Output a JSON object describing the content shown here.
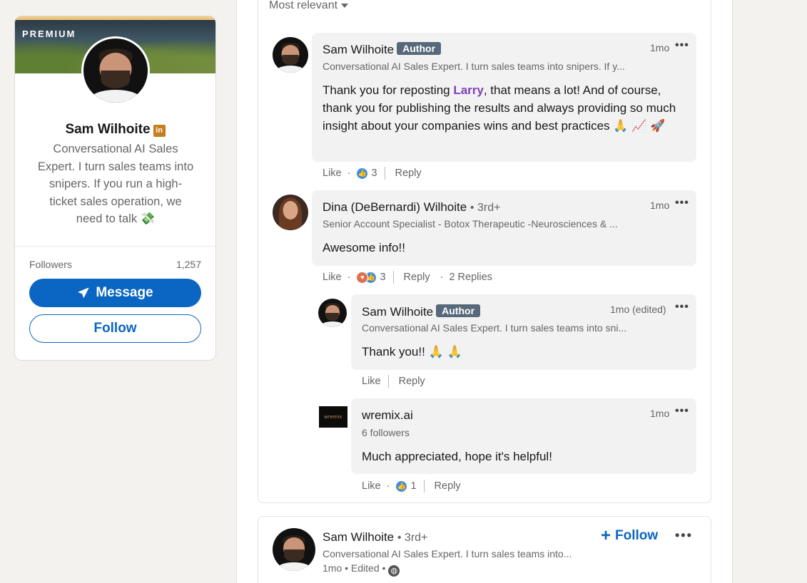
{
  "profile": {
    "premium_label": "PREMIUM",
    "name": "Sam Wilhoite",
    "linkedin_badge": "in",
    "headline": "Conversational AI Sales Expert. I turn sales teams into snipers. If you run a high-ticket sales operation, we need to talk 💸",
    "followers_label": "Followers",
    "followers_count": "1,257",
    "message_label": "Message",
    "follow_label": "Follow"
  },
  "sort": {
    "label": "Most relevant",
    "icon": "caret-down-icon"
  },
  "comments": [
    {
      "name": "Sam Wilhoite",
      "badge": "Author",
      "headline": "Conversational AI Sales Expert. I turn sales teams into snipers. If y...",
      "time": "1mo",
      "text_before": "Thank you for reposting ",
      "mention": "Larry",
      "text_after": ", that means a lot! And of course, thank you for publishing the results and always providing so much insight about your companies wins and best practices 🙏 📈 🚀",
      "like_label": "Like",
      "reaction_count": "3",
      "reply_label": "Reply"
    },
    {
      "name": "Dina (DeBernardi) Wilhoite",
      "degree": "• 3rd+",
      "headline": "Senior Account Specialist - Botox Therapeutic -Neurosciences & ...",
      "time": "1mo",
      "text": "Awesome info!!",
      "like_label": "Like",
      "reaction_count": "3",
      "reply_label": "Reply",
      "replies_label": "2 Replies",
      "replies": [
        {
          "name": "Sam Wilhoite",
          "badge": "Author",
          "headline": "Conversational AI Sales Expert. I turn sales teams into sni...",
          "time": "1mo (edited)",
          "text": "Thank you!! 🙏 🙏",
          "like_label": "Like",
          "reply_label": "Reply"
        },
        {
          "name": "wremix.ai",
          "logo_text": "wremix",
          "headline": "6 followers",
          "time": "1mo",
          "text": "Much appreciated, hope it's helpful!",
          "like_label": "Like",
          "reaction_count": "1",
          "reply_label": "Reply"
        }
      ]
    }
  ],
  "next_post": {
    "name": "Sam Wilhoite",
    "degree": "• 3rd+",
    "headline": "Conversational AI Sales Expert. I turn sales teams into...",
    "meta": "1mo • Edited •",
    "follow_label": "Follow"
  },
  "colors": {
    "brand_blue": "#0a66c2",
    "author_badge": "#56687a",
    "mention": "#7f3fbf",
    "bubble": "#f2f2f2"
  }
}
